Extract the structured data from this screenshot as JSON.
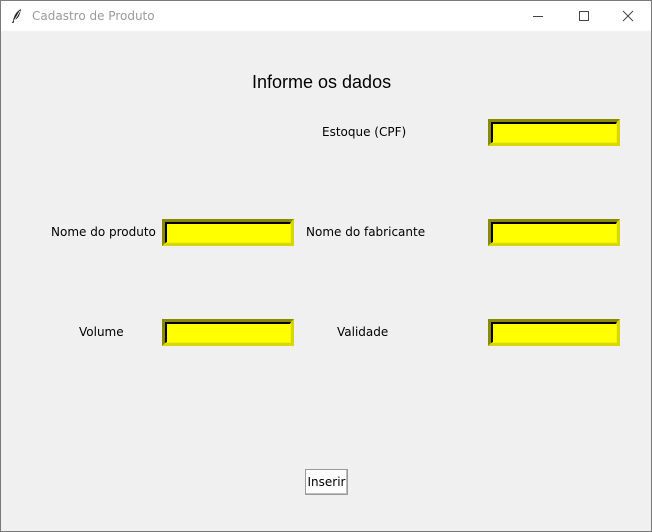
{
  "window": {
    "title": "Cadastro de Produto",
    "icon": "feather-icon"
  },
  "form": {
    "heading": "Informe os dados",
    "fields": {
      "estoque": {
        "label": "Estoque (CPF)",
        "value": ""
      },
      "nome_produto": {
        "label": "Nome do produto",
        "value": ""
      },
      "nome_fabricante": {
        "label": "Nome do fabricante",
        "value": ""
      },
      "volume": {
        "label": "Volume",
        "value": ""
      },
      "validade": {
        "label": "Validade",
        "value": ""
      }
    },
    "submit_label": "Inserir"
  },
  "colors": {
    "entry_background": "#ffff00",
    "window_background": "#f0f0f0"
  }
}
